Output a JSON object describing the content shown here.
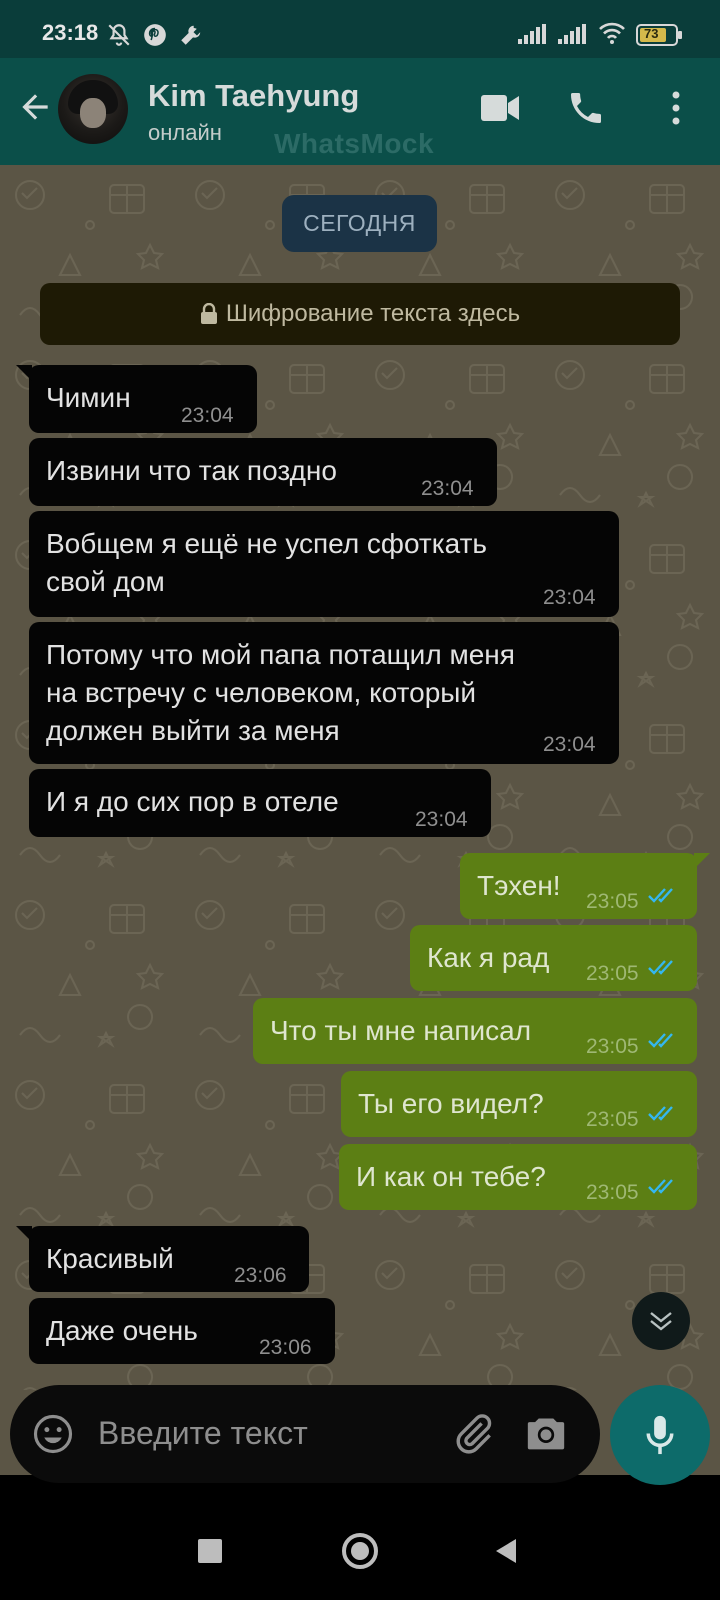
{
  "status_bar": {
    "time": "23:18",
    "left_icons": [
      "mute-notifications-icon",
      "pinterest-icon",
      "wrench-icon"
    ],
    "right_icons": [
      "signal-icon",
      "signal-icon",
      "wifi-icon",
      "battery-icon"
    ],
    "battery_level": "73"
  },
  "header": {
    "contact_name": "Kim Taehyung",
    "contact_status": "онлайн",
    "watermark": "WhatsMock",
    "icons": [
      "back-arrow-icon",
      "video-call-icon",
      "phone-icon",
      "more-vert-icon"
    ]
  },
  "chat": {
    "date_chip": "СЕГОДНЯ",
    "encryption_notice": "Шифрование текста здесь",
    "messages": [
      {
        "direction": "in",
        "text": "Чимин",
        "time": "23:04"
      },
      {
        "direction": "in",
        "text": "Извини что так поздно",
        "time": "23:04"
      },
      {
        "direction": "in",
        "text": "Вобщем я ещё не успел сфоткать\nсвой дом",
        "time": "23:04"
      },
      {
        "direction": "in",
        "text": "Потому что мой папа потащил меня\nна встречу с человеком, который\nдолжен выйти за меня",
        "time": "23:04"
      },
      {
        "direction": "in",
        "text": "И я до сих пор в отеле",
        "time": "23:04"
      },
      {
        "direction": "out",
        "text": "Тэхен!",
        "time": "23:05",
        "status": "read"
      },
      {
        "direction": "out",
        "text": "Как я рад",
        "time": "23:05",
        "status": "read"
      },
      {
        "direction": "out",
        "text": "Что ты мне написал",
        "time": "23:05",
        "status": "read"
      },
      {
        "direction": "out",
        "text": "Ты его видел?",
        "time": "23:05",
        "status": "read"
      },
      {
        "direction": "out",
        "text": "И как он тебе?",
        "time": "23:05",
        "status": "read"
      },
      {
        "direction": "in",
        "text": "Красивый",
        "time": "23:06"
      },
      {
        "direction": "in",
        "text": "Даже очень",
        "time": "23:06"
      }
    ]
  },
  "input": {
    "placeholder": "Введите текст",
    "icons": [
      "emoji-icon",
      "attach-icon",
      "camera-icon",
      "mic-icon"
    ]
  },
  "nav_bar": {
    "icons": [
      "recent-apps-icon",
      "home-icon",
      "back-icon"
    ]
  },
  "colors": {
    "header": "#0b4f49",
    "status_bar": "#0a3d3a",
    "chat_background": "#5b5545",
    "incoming_bubble": "#050505",
    "outgoing_bubble": "#5c7f14",
    "read_ticks": "#34b7f1",
    "mic_button": "#0d6b6a"
  }
}
